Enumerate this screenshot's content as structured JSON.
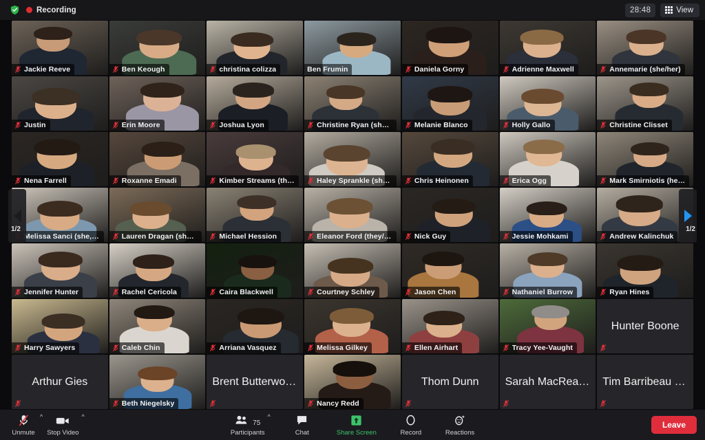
{
  "topbar": {
    "shield_icon": "encryption-shield-icon",
    "recording_dot_icon": "recording-dot-icon",
    "recording_label": "Recording",
    "timer": "28:48",
    "view_label": "View",
    "view_icon": "grid-view-icon"
  },
  "gallery": {
    "page_left_label": "1/2",
    "page_right_label": "1/2",
    "prev_icon": "chevron-left-icon",
    "next_icon": "chevron-right-icon",
    "mute_icon": "muted-microphone-icon",
    "participants": [
      {
        "name": "Jackie Reeve",
        "muted": true,
        "video": true,
        "speaking": false,
        "skin": "#c79a78",
        "hair": "#2d2119",
        "shirt": "#1f2733",
        "bg": "#6c6257"
      },
      {
        "name": "Ben Keough",
        "muted": true,
        "video": true,
        "speaking": false,
        "skin": "#d8ab86",
        "hair": "#4a372a",
        "shirt": "#4c6b52",
        "bg": "#3a3c3a"
      },
      {
        "name": "christina colizza",
        "muted": true,
        "video": true,
        "speaking": false,
        "skin": "#e0b48f",
        "hair": "#3a2b20",
        "shirt": "#22252b",
        "bg": "#b9b3a6"
      },
      {
        "name": "Ben Frumin",
        "muted": false,
        "video": true,
        "speaking": true,
        "skin": "#d6a97f",
        "hair": "#2b241d",
        "shirt": "#9cb7c4",
        "bg": "#8d9aa1"
      },
      {
        "name": "Daniela Gorny",
        "muted": true,
        "video": true,
        "speaking": false,
        "skin": "#cf9f78",
        "hair": "#1d1511",
        "shirt": "#2a1f1a",
        "bg": "#2d2621"
      },
      {
        "name": "Adrienne Maxwell",
        "muted": true,
        "video": true,
        "speaking": false,
        "skin": "#dcb18d",
        "hair": "#8a6a45",
        "shirt": "#2b2f3a",
        "bg": "#3d3832"
      },
      {
        "name": "Annemarie (she/her)",
        "muted": true,
        "video": true,
        "speaking": false,
        "skin": "#dbb08d",
        "hair": "#4b3526",
        "shirt": "#30343c",
        "bg": "#9a8f82"
      },
      {
        "name": "Justin",
        "muted": true,
        "video": true,
        "speaking": false,
        "skin": "#dcb08b",
        "hair": "#3c2f24",
        "shirt": "#20242c",
        "bg": "#4b4743"
      },
      {
        "name": "Erin Moore",
        "muted": true,
        "video": true,
        "speaking": false,
        "skin": "#dcb296",
        "hair": "#2f231a",
        "shirt": "#9a96a4",
        "bg": "#6f625a"
      },
      {
        "name": "Joshua Lyon",
        "muted": true,
        "video": true,
        "speaking": false,
        "skin": "#d2a683",
        "hair": "#2a231d",
        "shirt": "#1b1e24",
        "bg": "#b5ab9c"
      },
      {
        "name": "Christine Ryan (she, ...",
        "muted": true,
        "video": true,
        "speaking": false,
        "skin": "#d4a986",
        "hair": "#4a3627",
        "shirt": "#2c3138",
        "bg": "#8c8274"
      },
      {
        "name": "Melanie Blanco",
        "muted": true,
        "video": true,
        "speaking": false,
        "skin": "#c89c77",
        "hair": "#1d1612",
        "shirt": "#23262c",
        "bg": "#303a48"
      },
      {
        "name": "Holly Gallo",
        "muted": true,
        "video": true,
        "speaking": false,
        "skin": "#ddb693",
        "hair": "#6b4b30",
        "shirt": "#4a5b6b",
        "bg": "#cfc9bf"
      },
      {
        "name": "Christine Clisset",
        "muted": true,
        "video": true,
        "speaking": false,
        "skin": "#d9ac87",
        "hair": "#3b2c20",
        "shirt": "#262a31",
        "bg": "#9c958a"
      },
      {
        "name": "Nena Farrell",
        "muted": true,
        "video": true,
        "speaking": false,
        "skin": "#d6a980",
        "hair": "#241a14",
        "shirt": "#1d2026",
        "bg": "#2b2622"
      },
      {
        "name": "Roxanne Emadi",
        "muted": true,
        "video": true,
        "speaking": false,
        "skin": "#cb9c74",
        "hair": "#2b1f17",
        "shirt": "#7b6f64",
        "bg": "#56473c"
      },
      {
        "name": "Kimber Streams (the...",
        "muted": true,
        "video": true,
        "speaking": false,
        "skin": "#dcb28f",
        "hair": "#a9916f",
        "shirt": "#33282a",
        "bg": "#4a3b3c"
      },
      {
        "name": "Haley Sprankle (she/...",
        "muted": true,
        "video": true,
        "speaking": false,
        "skin": "#ddb492",
        "hair": "#5a4430",
        "shirt": "#cfcac2",
        "bg": "#b2aba0"
      },
      {
        "name": "Chris Heinonen",
        "muted": true,
        "video": true,
        "speaking": false,
        "skin": "#d3a77f",
        "hair": "#3a2e24",
        "shirt": "#232a33",
        "bg": "#55483c"
      },
      {
        "name": "Erica Ogg",
        "muted": true,
        "video": true,
        "speaking": false,
        "skin": "#e1b894",
        "hair": "#8b6c49",
        "shirt": "#d6d2cb",
        "bg": "#cdc7be"
      },
      {
        "name": "Mark Smirniotis (he/...",
        "muted": true,
        "video": true,
        "speaking": false,
        "skin": "#d6aa86",
        "hair": "#2e241c",
        "shirt": "#20242b",
        "bg": "#8f8679"
      },
      {
        "name": "Melissa Sanci (she, her)",
        "muted": true,
        "video": true,
        "speaking": false,
        "skin": "#d8ab85",
        "hair": "#3c2c20",
        "shirt": "#7d98ae",
        "bg": "#cdc6bb"
      },
      {
        "name": "Lauren Dragan (she/...",
        "muted": true,
        "video": true,
        "speaking": false,
        "skin": "#dcb08c",
        "hair": "#6a4b2e",
        "shirt": "#566050",
        "bg": "#7c6b58"
      },
      {
        "name": "Michael Hession",
        "muted": true,
        "video": true,
        "speaking": false,
        "skin": "#d2a37c",
        "hair": "#3d3027",
        "shirt": "#2b2f36",
        "bg": "#8a8274"
      },
      {
        "name": "Eleanor Ford (they/t...",
        "muted": true,
        "video": true,
        "speaking": false,
        "skin": "#dbb08d",
        "hair": "#6c5135",
        "shirt": "#b9b3aa",
        "bg": "#b8b1a6"
      },
      {
        "name": "Nick Guy",
        "muted": true,
        "video": true,
        "speaking": false,
        "skin": "#cfa27c",
        "hair": "#241b14",
        "shirt": "#1e2228",
        "bg": "#2b2723"
      },
      {
        "name": "Jessie Mohkami",
        "muted": true,
        "video": true,
        "speaking": false,
        "skin": "#d9ac85",
        "hair": "#2a1f18",
        "shirt": "#2c4f86",
        "bg": "#d4cec5"
      },
      {
        "name": "Andrew Kalinchuk",
        "muted": true,
        "video": true,
        "speaking": false,
        "skin": "#d7ab87",
        "hair": "#2e241c",
        "shirt": "#343a44",
        "bg": "#b5ada1"
      },
      {
        "name": "Jennifer Hunter",
        "muted": true,
        "video": true,
        "speaking": false,
        "skin": "#d9ad89",
        "hair": "#3a2a1e",
        "shirt": "#3a3f48",
        "bg": "#cac3b9"
      },
      {
        "name": "Rachel Cericola",
        "muted": true,
        "video": true,
        "speaking": false,
        "skin": "#d5a883",
        "hair": "#2d2119",
        "shirt": "#23262c",
        "bg": "#d6d0c6"
      },
      {
        "name": "Caira Blackwell",
        "muted": true,
        "video": true,
        "speaking": false,
        "skin": "#8a5f42",
        "hair": "#18120e",
        "shirt": "#1a2a1c",
        "bg": "#13200f"
      },
      {
        "name": "Courtney Schley",
        "muted": true,
        "video": true,
        "speaking": false,
        "skin": "#d6aa87",
        "hair": "#46331f",
        "shirt": "#6d5a4a",
        "bg": "#c6bfb4"
      },
      {
        "name": "Jason Chen",
        "muted": true,
        "video": true,
        "speaking": false,
        "skin": "#cb9d76",
        "hair": "#1d1510",
        "shirt": "#a9763f",
        "bg": "#2f2a25"
      },
      {
        "name": "Nathaniel Burrow",
        "muted": true,
        "video": true,
        "speaking": false,
        "skin": "#dcb08c",
        "hair": "#4e3a27",
        "shirt": "#8ba3bd",
        "bg": "#b7b0a5"
      },
      {
        "name": "Ryan Hines",
        "muted": true,
        "video": true,
        "speaking": false,
        "skin": "#cfa37e",
        "hair": "#241b15",
        "shirt": "#1f232a",
        "bg": "#3a352f"
      },
      {
        "name": "Harry Sawyers",
        "muted": true,
        "video": true,
        "speaking": false,
        "skin": "#d3a57f",
        "hair": "#3b2e23",
        "shirt": "#2a3040",
        "bg": "#c9b98f"
      },
      {
        "name": "Caleb Chin",
        "muted": true,
        "video": true,
        "speaking": false,
        "skin": "#d9ae88",
        "hair": "#211912",
        "shirt": "#dad6cf",
        "bg": "#8f867a"
      },
      {
        "name": "Arriana Vasquez",
        "muted": true,
        "video": true,
        "speaking": false,
        "skin": "#c99a73",
        "hair": "#1e1611",
        "shirt": "#262a31",
        "bg": "#2a2622"
      },
      {
        "name": "Melissa Gilkey",
        "muted": true,
        "video": true,
        "speaking": false,
        "skin": "#dcb28e",
        "hair": "#7d5c3a",
        "shirt": "#b4614a",
        "bg": "#3b352e"
      },
      {
        "name": "Ellen Airhart",
        "muted": true,
        "video": true,
        "speaking": false,
        "skin": "#dbb08c",
        "hair": "#2d2118",
        "shirt": "#8e4040",
        "bg": "#9a938a"
      },
      {
        "name": "Tracy Yee-Vaught",
        "muted": true,
        "video": true,
        "speaking": false,
        "skin": "#d2a47e",
        "hair": "#8f8c8a",
        "shirt": "#7d3340",
        "bg": "#4d6b3a"
      },
      {
        "name": "Hunter Boone",
        "muted": true,
        "video": false,
        "speaking": false,
        "skin": "",
        "hair": "",
        "shirt": "",
        "bg": ""
      },
      {
        "name": "Arthur Gies",
        "muted": true,
        "video": false,
        "speaking": false,
        "skin": "",
        "hair": "",
        "shirt": "",
        "bg": ""
      },
      {
        "name": "Beth Niegelsky",
        "muted": true,
        "video": true,
        "speaking": false,
        "skin": "#dcb18e",
        "hair": "#6b4326",
        "shirt": "#3f6fa0",
        "bg": "#9b968d"
      },
      {
        "name": "Brent Butterworth",
        "muted": true,
        "video": false,
        "speaking": false,
        "skin": "",
        "hair": "",
        "shirt": "",
        "bg": ""
      },
      {
        "name": "Nancy Redd",
        "muted": true,
        "video": true,
        "speaking": false,
        "skin": "#8c5e40",
        "hair": "#16100c",
        "shirt": "#241a16",
        "bg": "#c6b79a"
      },
      {
        "name": "Thom Dunn",
        "muted": true,
        "video": false,
        "speaking": false,
        "skin": "",
        "hair": "",
        "shirt": "",
        "bg": ""
      },
      {
        "name": "Sarah MacReading",
        "muted": true,
        "video": false,
        "speaking": false,
        "skin": "",
        "hair": "",
        "shirt": "",
        "bg": ""
      },
      {
        "name": "Tim Barribeau (he...",
        "muted": true,
        "video": false,
        "speaking": false,
        "skin": "",
        "hair": "",
        "shirt": "",
        "bg": ""
      }
    ]
  },
  "toolbar": {
    "unmute_label": "Unmute",
    "unmute_icon": "muted-microphone-icon",
    "unmute_caret_icon": "chevron-up-icon",
    "stop_video_label": "Stop Video",
    "stop_video_icon": "video-camera-icon",
    "stop_video_caret_icon": "chevron-up-icon",
    "participants_label": "Participants",
    "participants_icon": "people-icon",
    "participants_count": "75",
    "participants_caret_icon": "chevron-up-icon",
    "chat_label": "Chat",
    "chat_icon": "speech-bubble-icon",
    "share_label": "Share Screen",
    "share_icon": "share-screen-up-arrow-icon",
    "record_label": "Record",
    "record_icon": "record-circle-icon",
    "reactions_label": "Reactions",
    "reactions_icon": "reactions-smiley-icon",
    "leave_label": "Leave",
    "share_color": "#3dc36a",
    "leave_color": "#e02d3c"
  }
}
